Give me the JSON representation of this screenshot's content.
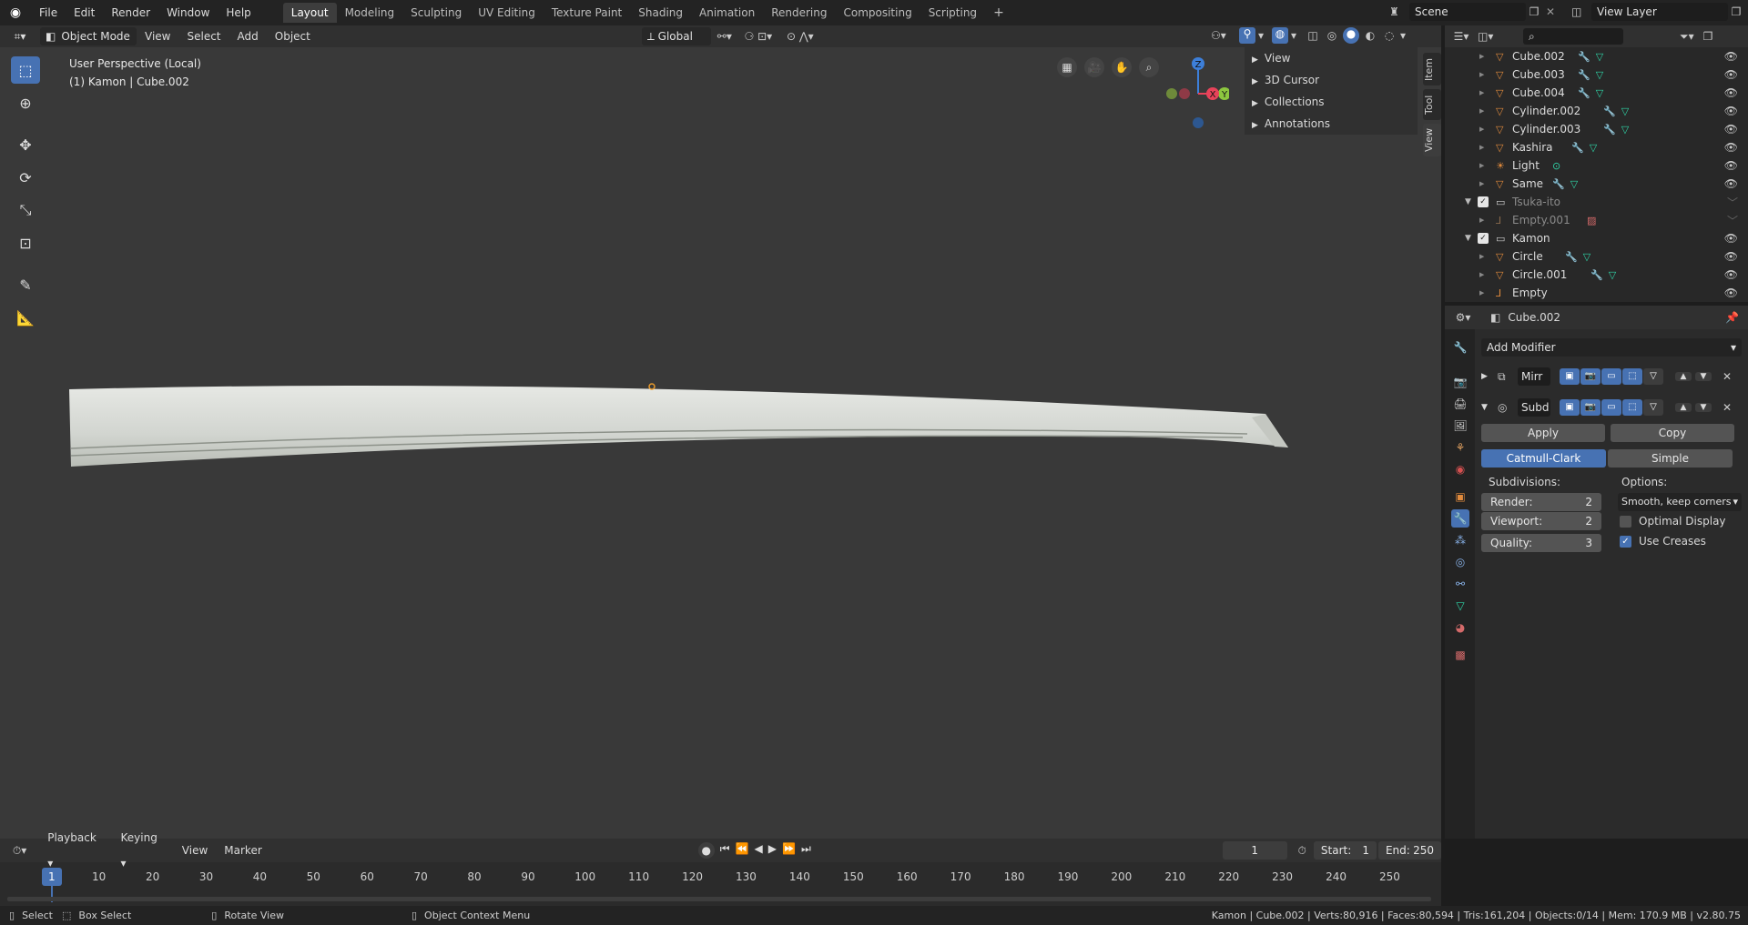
{
  "topbar": {
    "menus": [
      "File",
      "Edit",
      "Render",
      "Window",
      "Help"
    ],
    "workspaces": [
      "Layout",
      "Modeling",
      "Sculpting",
      "UV Editing",
      "Texture Paint",
      "Shading",
      "Animation",
      "Rendering",
      "Compositing",
      "Scripting"
    ],
    "add_tab": "+",
    "scene": "Scene",
    "view_layer": "View Layer"
  },
  "viewport": {
    "mode": "Object Mode",
    "menus": [
      "View",
      "Select",
      "Add",
      "Object"
    ],
    "orientation": "Global",
    "info_line1": "User Perspective (Local)",
    "info_line2": "(1) Kamon | Cube.002",
    "axes": {
      "z": "Z",
      "y": "Y",
      "x": "X"
    },
    "npanel": [
      "View",
      "3D Cursor",
      "Collections",
      "Annotations"
    ],
    "vtabs": [
      "Item",
      "Tool",
      "View"
    ]
  },
  "outliner": {
    "search_placeholder": "",
    "rows": [
      {
        "name": "Cube.002",
        "type": "mesh",
        "indent": 2,
        "mods": true,
        "dim": false
      },
      {
        "name": "Cube.003",
        "type": "mesh",
        "indent": 2,
        "mods": true,
        "dim": false
      },
      {
        "name": "Cube.004",
        "type": "mesh",
        "indent": 2,
        "mods": true,
        "dim": false
      },
      {
        "name": "Cylinder.002",
        "type": "mesh",
        "indent": 2,
        "mods": true,
        "dim": false
      },
      {
        "name": "Cylinder.003",
        "type": "mesh",
        "indent": 2,
        "mods": true,
        "dim": false
      },
      {
        "name": "Kashira",
        "type": "mesh",
        "indent": 2,
        "mods": true,
        "dim": false
      },
      {
        "name": "Light",
        "type": "light",
        "indent": 2,
        "mods": false,
        "dim": false
      },
      {
        "name": "Same",
        "type": "mesh",
        "indent": 2,
        "mods": true,
        "dim": false
      },
      {
        "name": "Tsuka-ito",
        "type": "collection",
        "indent": 1,
        "mods": false,
        "dim": true
      },
      {
        "name": "Empty.001",
        "type": "empty",
        "indent": 2,
        "mods": false,
        "dim": true
      },
      {
        "name": "Kamon",
        "type": "collection",
        "indent": 1,
        "mods": false,
        "dim": false
      },
      {
        "name": "Circle",
        "type": "mesh",
        "indent": 2,
        "mods": true,
        "dim": false
      },
      {
        "name": "Circle.001",
        "type": "mesh",
        "indent": 2,
        "mods": true,
        "dim": false
      },
      {
        "name": "Empty",
        "type": "empty",
        "indent": 2,
        "mods": false,
        "dim": false
      }
    ]
  },
  "properties": {
    "object_name": "Cube.002",
    "add_modifier": "Add Modifier",
    "mod1_name": "Mirr",
    "mod2_name": "Subd",
    "apply": "Apply",
    "copy": "Copy",
    "catmull": "Catmull-Clark",
    "simple": "Simple",
    "subdivisions": "Subdivisions:",
    "options": "Options:",
    "render_label": "Render:",
    "render_val": "2",
    "viewport_label": "Viewport:",
    "viewport_val": "2",
    "quality_label": "Quality:",
    "quality_val": "3",
    "uv_smooth": "Smooth, keep corners",
    "optimal_display": "Optimal Display",
    "use_creases": "Use Creases",
    "optimal_checked": false,
    "creases_checked": true
  },
  "timeline": {
    "menus": [
      "Playback",
      "Keying",
      "View",
      "Marker"
    ],
    "current_frame": "1",
    "start_label": "Start:",
    "start": "1",
    "end_label": "End:",
    "end": "250",
    "ticks": [
      "1",
      "10",
      "20",
      "30",
      "40",
      "50",
      "60",
      "70",
      "80",
      "90",
      "100",
      "110",
      "120",
      "130",
      "140",
      "150",
      "160",
      "170",
      "180",
      "190",
      "200",
      "210",
      "220",
      "230",
      "240",
      "250"
    ]
  },
  "statusbar": {
    "select": "Select",
    "box_select": "Box Select",
    "rotate_view": "Rotate View",
    "context_menu": "Object Context Menu",
    "stats": "Kamon | Cube.002 | Verts:80,916 | Faces:80,594 | Tris:161,204 | Objects:0/14 | Mem: 170.9 MB | v2.80.75"
  },
  "colors": {
    "accent": "#4772b3",
    "mesh_icon": "#2fd3a6",
    "object_icon": "#e08a3c",
    "viewport_bg": "#393939"
  }
}
